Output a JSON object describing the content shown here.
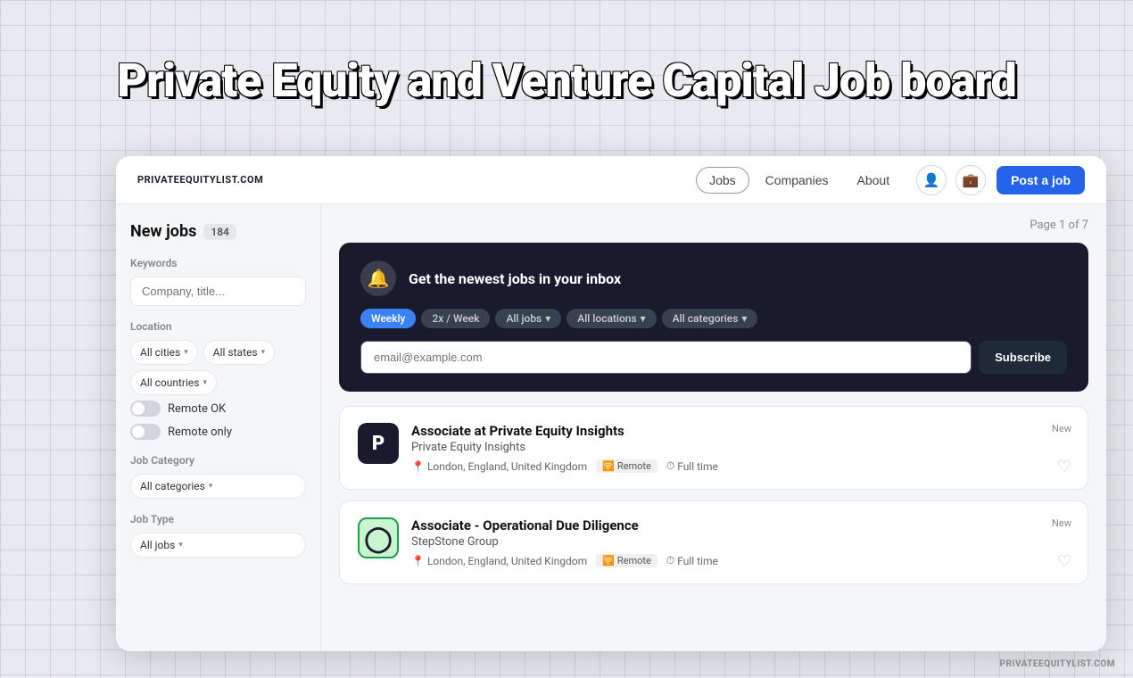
{
  "page": {
    "title": "Private Equity and Venture Capital Job board"
  },
  "nav": {
    "brand": "PRIVATEEQUITYLIST.COM",
    "links": [
      {
        "label": "Jobs",
        "active": true
      },
      {
        "label": "Companies",
        "active": false
      },
      {
        "label": "About",
        "active": false
      }
    ],
    "post_job_label": "Post a job",
    "footer_brand": "PRIVATEEQUITYLIST.COM"
  },
  "sidebar": {
    "new_jobs_label": "New jobs",
    "jobs_count": "184",
    "keywords_label": "Keywords",
    "keywords_placeholder": "Company, title...",
    "location_label": "Location",
    "all_cities": "All cities",
    "all_states": "All states",
    "all_countries": "All countries",
    "remote_ok_label": "Remote OK",
    "remote_only_label": "Remote only",
    "job_category_label": "Job Category",
    "all_categories": "All categories",
    "job_type_label": "Job Type",
    "all_jobs": "All jobs"
  },
  "main": {
    "page_info": "Page 1 of 7"
  },
  "subscribe": {
    "title": "Get the newest jobs in your inbox",
    "frequency": {
      "weekly_label": "Weekly",
      "twice_label": "2x / Week"
    },
    "tags": [
      {
        "label": "All jobs",
        "type": "dropdown",
        "active": false
      },
      {
        "label": "All locations",
        "type": "dropdown",
        "active": false
      },
      {
        "label": "All categories",
        "type": "dropdown",
        "active": false
      }
    ],
    "email_placeholder": "email@example.com",
    "subscribe_label": "Subscribe"
  },
  "jobs": [
    {
      "id": 1,
      "title": "Associate at Private Equity Insights",
      "company": "Private Equity Insights",
      "location": "London, England, United Kingdom",
      "remote": "Remote",
      "type": "Full time",
      "badge": "New",
      "logo_text": "P",
      "logo_style": "dark"
    },
    {
      "id": 2,
      "title": "Associate - Operational Due Diligence",
      "company": "StepStone Group",
      "location": "London, England, United Kingdom",
      "remote": "Remote",
      "type": "Full time",
      "badge": "New",
      "logo_text": "○",
      "logo_style": "green"
    }
  ]
}
